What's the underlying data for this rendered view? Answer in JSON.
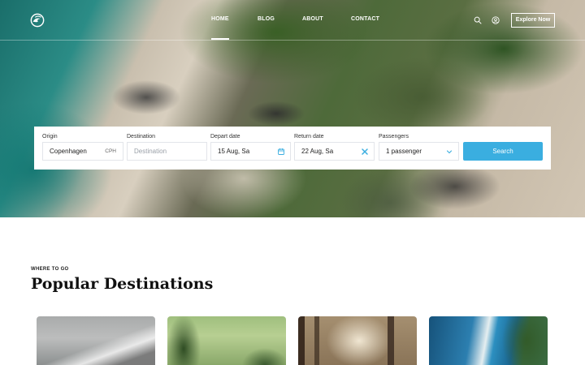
{
  "nav": {
    "links": [
      {
        "label": "HOME",
        "active": true
      },
      {
        "label": "BLOG",
        "active": false
      },
      {
        "label": "ABOUT",
        "active": false
      },
      {
        "label": "CONTACT",
        "active": false
      }
    ],
    "icons": [
      "search-icon",
      "user-icon"
    ],
    "cta_label": "Explore Now"
  },
  "search": {
    "origin": {
      "label": "Origin",
      "value": "Copenhagen",
      "code": "CPH"
    },
    "destination": {
      "label": "Destination",
      "placeholder": "Destination"
    },
    "depart": {
      "label": "Depart date",
      "value": "15 Aug, Sa",
      "icon": "calendar-icon"
    },
    "return_date": {
      "label": "Return date",
      "value": "22 Aug, Sa",
      "icon": "clear-icon"
    },
    "passengers": {
      "label": "Passengers",
      "value": "1 passenger",
      "icon": "chevron-down-icon"
    },
    "button_label": "Search"
  },
  "section": {
    "eyebrow": "WHERE TO GO",
    "title": "Popular Destinations"
  },
  "colors": {
    "accent": "#3aaee0",
    "calendar_icon": "#3aaee0",
    "clear_icon": "#3aaee0"
  }
}
